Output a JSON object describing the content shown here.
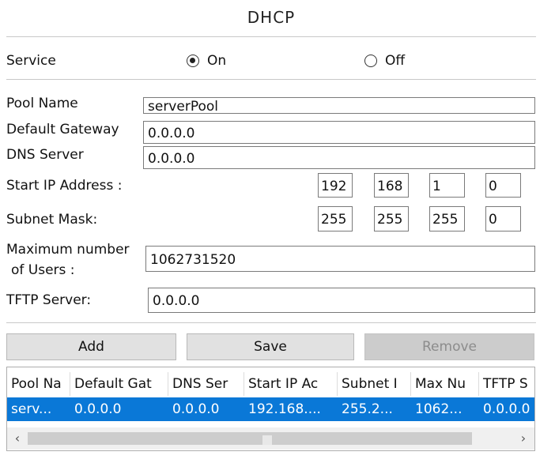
{
  "title": "DHCP",
  "service": {
    "label": "Service",
    "on_label": "On",
    "off_label": "Off",
    "selected": "On"
  },
  "fields": {
    "pool_name": {
      "label": "Pool Name",
      "value": "serverPool"
    },
    "default_gateway": {
      "label": "Default Gateway",
      "value": "0.0.0.0"
    },
    "dns_server": {
      "label": "DNS Server",
      "value": "0.0.0.0"
    },
    "start_ip": {
      "label": "Start IP Address :",
      "octets": [
        "192",
        "168",
        "1",
        "0"
      ]
    },
    "subnet_mask": {
      "label": "Subnet Mask:",
      "octets": [
        "255",
        "255",
        "255",
        "0"
      ]
    },
    "max_users": {
      "label_line1": "Maximum number",
      "label_line2": "of Users :",
      "value": "1062731520"
    },
    "tftp_server": {
      "label": "TFTP Server:",
      "value": "0.0.0.0"
    }
  },
  "buttons": {
    "add": "Add",
    "save": "Save",
    "remove": "Remove",
    "remove_enabled": false
  },
  "table": {
    "columns": [
      "Pool Na",
      "Default Gat",
      "DNS Ser",
      "Start IP Ac",
      "Subnet I",
      "Max Nu",
      "TFTP S"
    ],
    "rows": [
      [
        "serv...",
        "0.0.0.0",
        "0.0.0.0",
        "192.168....",
        "255.2...",
        "1062...",
        "0.0.0.0"
      ]
    ],
    "selected_row": 0
  },
  "scrollbar": {
    "left_arrow": "‹",
    "right_arrow": "›"
  },
  "colors": {
    "selection": "#0a78d7",
    "button": "#e1e1e1",
    "button_disabled": "#cccccc"
  }
}
